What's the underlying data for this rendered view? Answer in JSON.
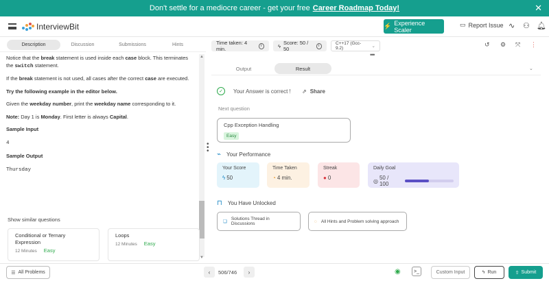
{
  "banner": {
    "text": "Don't settle for a mediocre career - get your free",
    "link": "Career Roadmap Today!",
    "close": "✕"
  },
  "header": {
    "logo": "InterviewBit",
    "experience_button": "Experience Scaler",
    "report_issue": "Report Issue"
  },
  "left_tabs": [
    "Description",
    "Discussion",
    "Submissions",
    "Hints"
  ],
  "description": {
    "p1_a": "Notice that the ",
    "p1_b": "break",
    "p1_c": " statement is used inside each ",
    "p1_d": "case",
    "p1_e": " block. This terminates the ",
    "p1_f": "switch",
    "p1_g": " statement.",
    "p2_a": "If the ",
    "p2_b": "break",
    "p2_c": " statement is not used, all cases after the correct ",
    "p2_d": "case",
    "p2_e": " are executed.",
    "p3": "Try the following example in the editor below.",
    "p4_a": "Given the ",
    "p4_b": "weekday number",
    "p4_c": ", print the ",
    "p4_d": "weekday name",
    "p4_e": " corresponding to it.",
    "p5_a": "Note:",
    "p5_b": " Day 1 is ",
    "p5_c": "Monday",
    "p5_d": ". First letter is always ",
    "p5_e": "Capital",
    "p5_f": ".",
    "sample_input_label": "Sample Input",
    "sample_input": "4",
    "sample_output_label": "Sample Output",
    "sample_output": "Thursday"
  },
  "similar": {
    "title": "Show similar questions",
    "items": [
      {
        "title": "Conditional or Ternary Expression",
        "time": "12 Minutes",
        "level": "Easy"
      },
      {
        "title": "Loops",
        "time": "12 Minutes",
        "level": "Easy"
      }
    ]
  },
  "editor_bar": {
    "time_taken": "Time taken: 4 min.",
    "score": "Score:  50  /  50",
    "language": "C++17 (Gcc-9.2)"
  },
  "result_tabs": [
    "Output",
    "Result"
  ],
  "result": {
    "correct": "Your Answer is correct !",
    "share": "Share",
    "next_label": "Next question",
    "next_title": "Cpp Exception Handling",
    "next_level": "Easy"
  },
  "performance": {
    "title": "Your Performance",
    "score_label": "Your Score",
    "score_value": "50",
    "time_label": "Time Taken",
    "time_value": "4 min.",
    "streak_label": "Streak",
    "streak_value": "0",
    "goal_label": "Daily Goal",
    "goal_value": "50 / 100",
    "goal_fraction": 0.5
  },
  "unlocked": {
    "title": "You Have Unlocked",
    "items": [
      "Solutions Thread in Discussions",
      "All Hints and Problem solving approach"
    ]
  },
  "bottom": {
    "all_problems": "All Problems",
    "pager": "506/746",
    "custom_input": "Custom Input",
    "run": "Run",
    "submit": "Submit"
  }
}
